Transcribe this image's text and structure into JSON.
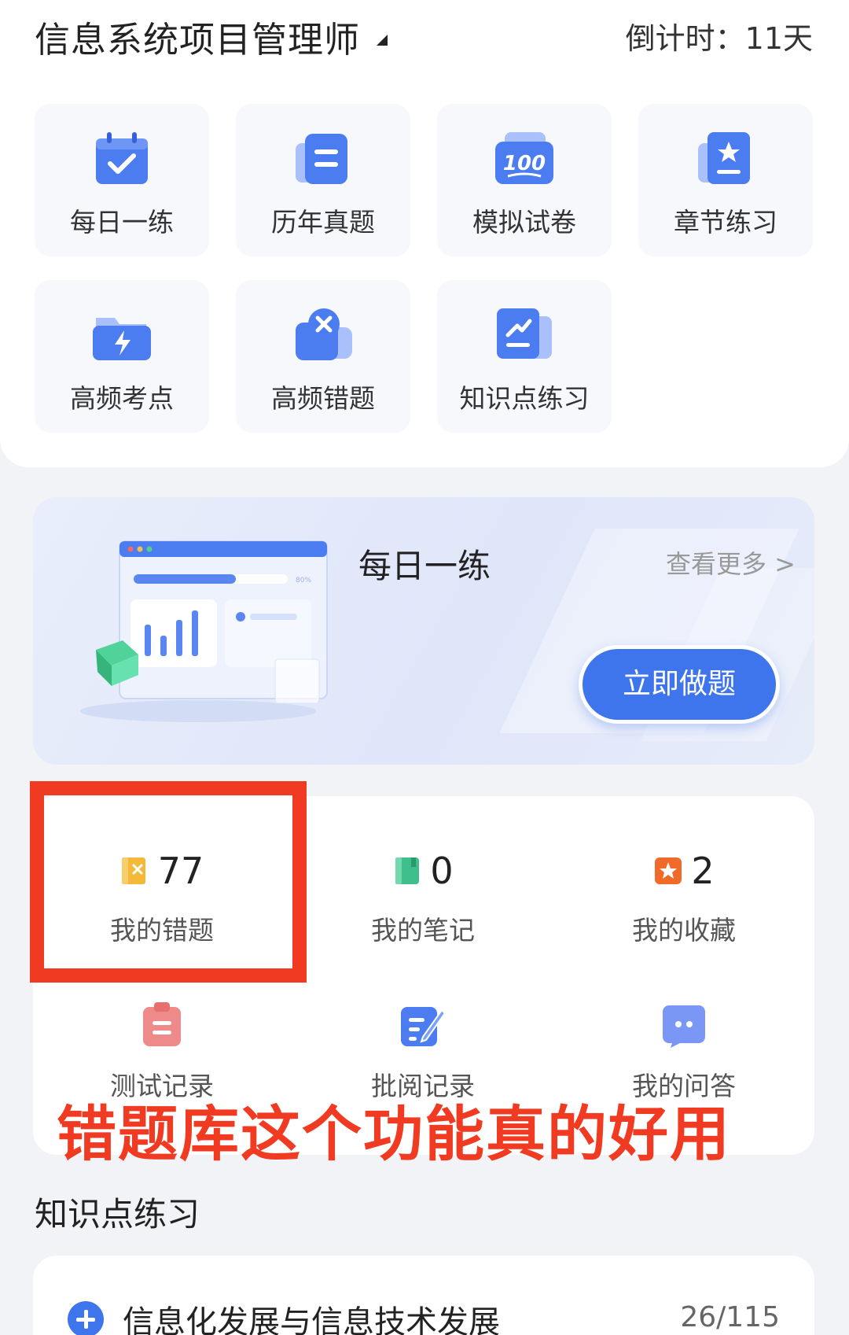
{
  "header": {
    "title": "信息系统项目管理师",
    "countdown": "倒计时：11天"
  },
  "tiles": [
    {
      "label": "每日一练",
      "icon": "calendar-check-icon"
    },
    {
      "label": "历年真题",
      "icon": "document-list-icon"
    },
    {
      "label": "模拟试卷",
      "icon": "score-100-icon"
    },
    {
      "label": "章节练习",
      "icon": "star-book-icon"
    },
    {
      "label": "高频考点",
      "icon": "lightning-folder-icon"
    },
    {
      "label": "高频错题",
      "icon": "error-x-icon"
    },
    {
      "label": "知识点练习",
      "icon": "trend-chart-icon"
    }
  ],
  "banner": {
    "title": "每日一练",
    "more": "查看更多 >",
    "button": "立即做题",
    "illustration_progress": "80%"
  },
  "stats": [
    {
      "value": "77",
      "label": "我的错题",
      "icon": "wrong-book-icon"
    },
    {
      "value": "0",
      "label": "我的笔记",
      "icon": "notebook-icon"
    },
    {
      "value": "2",
      "label": "我的收藏",
      "icon": "favorite-star-icon"
    }
  ],
  "subs": [
    {
      "label": "测试记录",
      "icon": "clipboard-icon"
    },
    {
      "label": "批阅记录",
      "icon": "edit-list-icon"
    },
    {
      "label": "我的问答",
      "icon": "chat-bubble-icon"
    }
  ],
  "overlay_caption": "错题库这个功能真的好用",
  "section": {
    "title": "知识点练习",
    "items": [
      {
        "label": "信息化发展与信息技术发展",
        "count": "26/115"
      }
    ]
  },
  "colors": {
    "accent": "#3e74ec",
    "highlight_red": "#f03a22",
    "stat_yellow": "#f5b93a",
    "stat_green": "#3fbf8a",
    "stat_orange": "#f06a2a"
  }
}
